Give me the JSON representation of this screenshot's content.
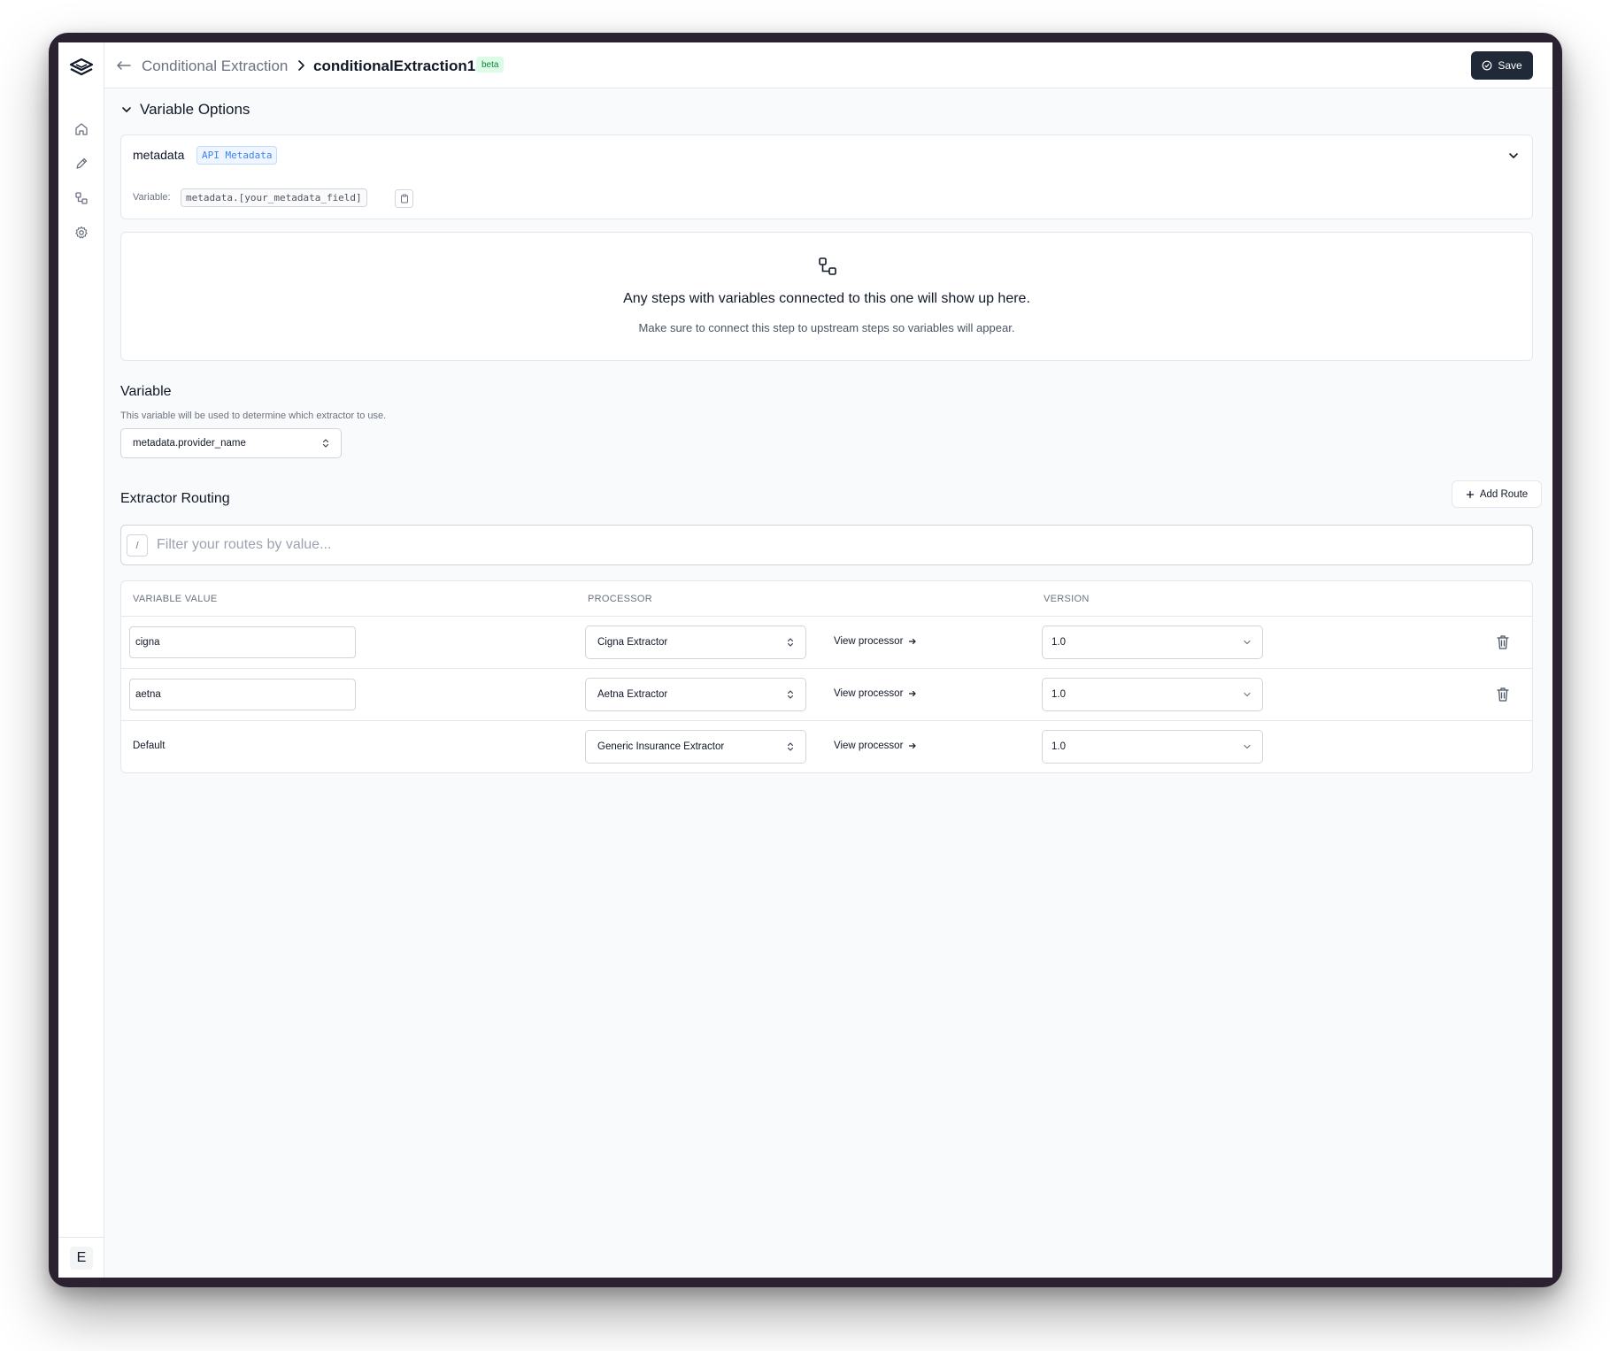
{
  "header": {
    "breadcrumb_parent": "Conditional Extraction",
    "breadcrumb_current": "conditionalExtraction1",
    "badge": "beta",
    "save_label": "Save"
  },
  "sidebar": {
    "items": [
      "home-icon",
      "pencil-icon",
      "workflow-icon",
      "gear-icon"
    ],
    "avatar_initial": "E"
  },
  "variable_options": {
    "title": "Variable Options",
    "metadata": {
      "name": "metadata",
      "badge": "API Metadata",
      "variable_label": "Variable:",
      "variable_code": "metadata.[your_metadata_field]"
    },
    "empty_state": {
      "title": "Any steps with variables connected to this one will show up here.",
      "subtitle": "Make sure to connect this step to upstream steps so variables will appear."
    }
  },
  "variable": {
    "title": "Variable",
    "help": "This variable will be used to determine which extractor to use.",
    "selected": "metadata.provider_name"
  },
  "routing": {
    "title": "Extractor Routing",
    "add_route_label": "Add Route",
    "filter_placeholder": "Filter your routes by value...",
    "filter_key": "/",
    "columns": [
      "VARIABLE VALUE",
      "PROCESSOR",
      "VERSION"
    ],
    "view_label": "View processor",
    "rows": [
      {
        "value": "cigna",
        "processor": "Cigna Extractor",
        "version": "1.0",
        "editable": true
      },
      {
        "value": "aetna",
        "processor": "Aetna Extractor",
        "version": "1.0",
        "editable": true
      },
      {
        "value": "Default",
        "processor": "Generic Insurance Extractor",
        "version": "1.0",
        "editable": false
      }
    ]
  },
  "colors": {
    "primary_button": "#1f2937",
    "badge_green_bg": "#dcfce7",
    "badge_blue_text": "#3b82f6"
  }
}
